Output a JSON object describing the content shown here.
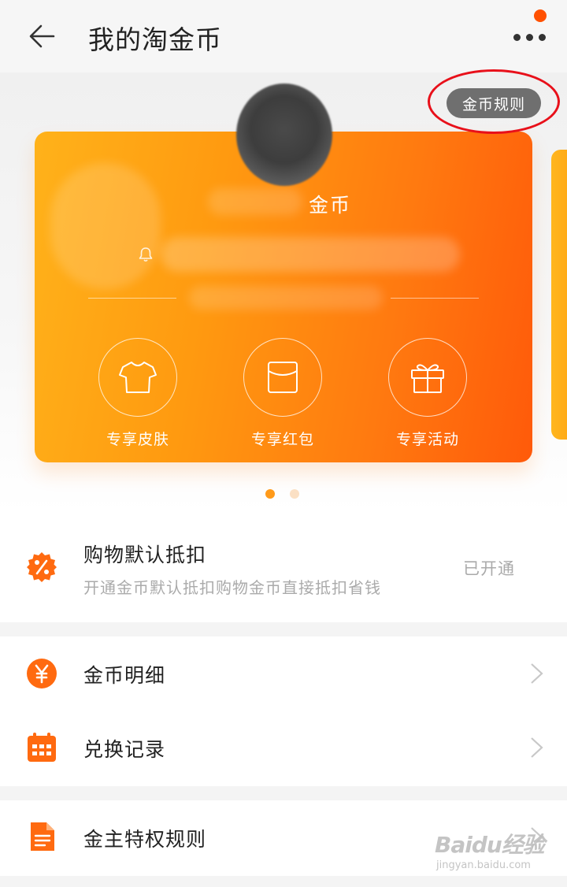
{
  "header": {
    "title": "我的淘金币",
    "back_icon": "back-arrow-icon",
    "more_icon": "more-dots-icon"
  },
  "rules_button": {
    "label": "金币规则"
  },
  "card": {
    "coin_label": "金币",
    "bell_icon": "bell-icon",
    "features": [
      {
        "label": "专享皮肤",
        "icon": "tshirt-icon"
      },
      {
        "label": "专享红包",
        "icon": "red-envelope-icon"
      },
      {
        "label": "专享活动",
        "icon": "gift-icon"
      }
    ],
    "colors": {
      "start": "#ffb21a",
      "end": "#ff5a0a"
    }
  },
  "pager": {
    "count": 2,
    "active": 0,
    "active_color": "#ff9a1a",
    "inactive_color": "#fbe0c4"
  },
  "deduction": {
    "title": "购物默认抵扣",
    "subtitle": "开通金币默认抵扣购物金币直接抵扣省钱",
    "status": "已开通",
    "icon": "percent-badge-icon"
  },
  "menu": [
    {
      "label": "金币明细",
      "icon": "yen-coin-icon"
    },
    {
      "label": "兑换记录",
      "icon": "calendar-icon"
    }
  ],
  "privilege": {
    "label": "金主特权规则",
    "icon": "document-icon"
  },
  "watermark": {
    "main": "Baidu经验",
    "sub": "jingyan.baidu.com"
  },
  "accent_color": "#ff5000"
}
